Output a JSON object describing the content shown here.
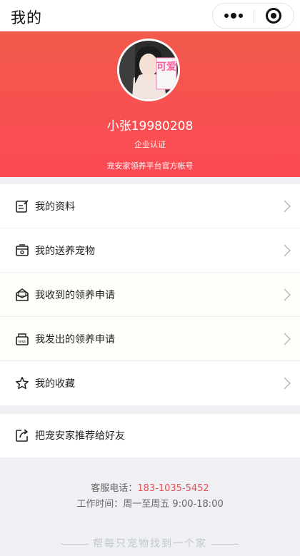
{
  "nav": {
    "title": "我的",
    "more_icon": "more-dots-icon",
    "close_icon": "target-circle-icon"
  },
  "profile": {
    "username": "小张19980208",
    "certification": "企业认证",
    "official_account": "宠安家领养平台官方帐号",
    "avatar_text": "可爱",
    "colors": {
      "gradient_top": "#f25a4b",
      "gradient_bottom": "#fc4a55"
    }
  },
  "menu": {
    "items": [
      {
        "label": "我的资料",
        "icon": "edit-profile-icon"
      },
      {
        "label": "我的送养宠物",
        "icon": "pet-box-icon"
      },
      {
        "label": "我收到的领养申请",
        "icon": "inbox-envelope-icon"
      },
      {
        "label": "我发出的领养申请",
        "icon": "sent-envelope-icon"
      },
      {
        "label": "我的收藏",
        "icon": "star-icon"
      }
    ]
  },
  "share": {
    "label": "把宠安家推荐给好友",
    "icon": "share-icon"
  },
  "footer": {
    "phone_label": "客服电话：",
    "phone_number": "183-1035-5452",
    "hours": "工作时间：周一至周五 9:00-18:00",
    "slogan": "帮每只宠物找到一个家",
    "accent_color": "#e45356"
  }
}
